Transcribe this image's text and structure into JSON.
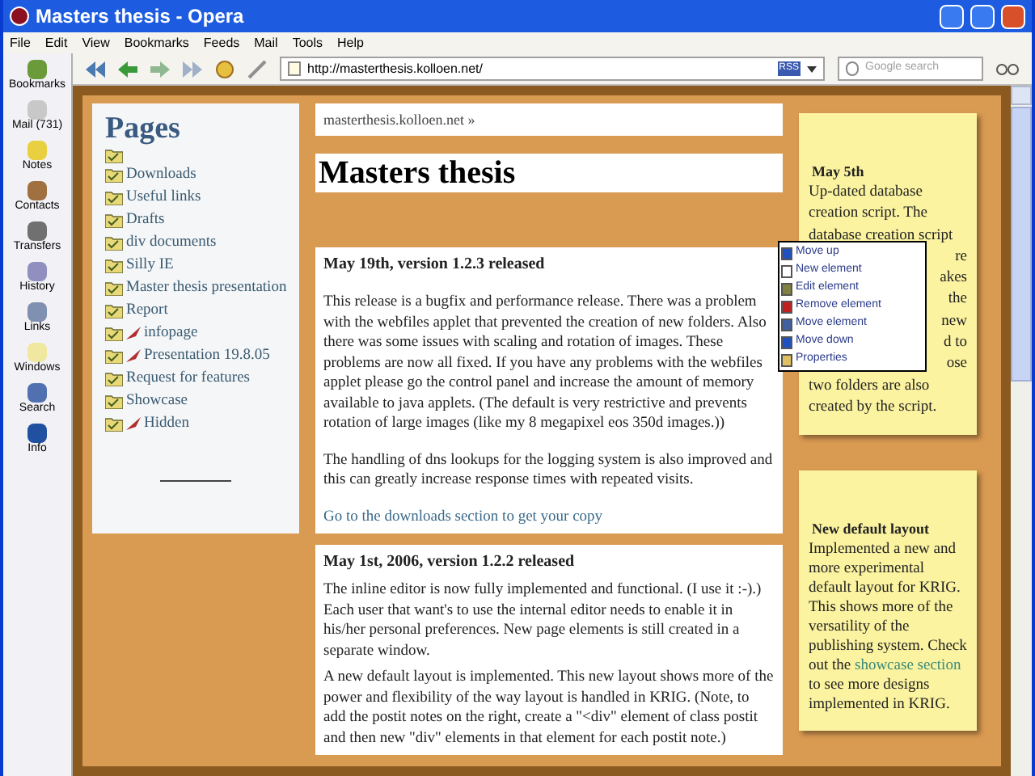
{
  "window": {
    "title": "Masters thesis - Opera"
  },
  "menu": [
    "File",
    "Edit",
    "View",
    "Bookmarks",
    "Feeds",
    "Mail",
    "Tools",
    "Help"
  ],
  "panel": [
    {
      "label": "Bookmarks"
    },
    {
      "label": "Mail (731)"
    },
    {
      "label": "Notes"
    },
    {
      "label": "Contacts"
    },
    {
      "label": "Transfers"
    },
    {
      "label": "History"
    },
    {
      "label": "Links"
    },
    {
      "label": "Windows"
    },
    {
      "label": "Search"
    },
    {
      "label": "Info"
    }
  ],
  "address": {
    "value": "http://masterthesis.kolloen.net/",
    "feed_badge": "RSS"
  },
  "search": {
    "placeholder": "Google search"
  },
  "pages": {
    "title": "Pages",
    "items": [
      {
        "marked": false
      },
      {
        "label": "Downloads",
        "marked": false
      },
      {
        "label": "Useful links",
        "marked": false
      },
      {
        "label": "Drafts",
        "marked": false
      },
      {
        "label": "div documents",
        "marked": false
      },
      {
        "label": "Silly IE",
        "marked": false
      },
      {
        "label": "Master thesis presentation",
        "marked": false
      },
      {
        "label": "Report",
        "marked": false
      },
      {
        "label": "infopage",
        "marked": true
      },
      {
        "label": "Presentation 19.8.05",
        "marked": true
      },
      {
        "label": "Request for features",
        "marked": false
      },
      {
        "label": "Showcase",
        "marked": false
      },
      {
        "label": "Hidden",
        "marked": true
      }
    ]
  },
  "breadcrumb": "masterthesis.kolloen.net »",
  "page_title": "Masters thesis",
  "posts": [
    {
      "title": "May 19th, version 1.2.3 released",
      "paragraphs": [
        {
          "kind": "text",
          "text": "This release is a bugfix and performance release. There was a problem with the webfiles applet that prevented the creation of new folders. Also there was some issues with scaling and rotation of images. These problems are now all fixed. If you have any problems with the webfiles applet please go the control panel and increase the amount of memory available to java applets. (The default is very restrictive and prevents rotation of large images (like my 8 megapixel eos 350d images.))"
        },
        {
          "kind": "text",
          "text": "The handling of dns lookups for the logging system is also improved and this can greatly increase response times with repeated visits."
        },
        {
          "kind": "link",
          "text": "Go to the downloads section to get your copy"
        }
      ]
    },
    {
      "title": "May 1st, 2006, version 1.2.2 released",
      "paragraphs": [
        {
          "kind": "text",
          "text": "The inline editor is now fully implemented and functional. (I use it :-).) Each user that want's to use the internal editor needs to enable it in his/her personal preferences. New page elements is still created in a separate window."
        },
        {
          "kind": "text",
          "text": "A new default layout is implemented. This new layout shows more of the power and flexibility of the way layout is handled in KRIG. (Note, to add the postit notes on the right, create a \"<div\" element of class postit and then new \"div\" elements in that element for each postit note.)"
        }
      ]
    }
  ],
  "context_menu": [
    {
      "label": "Move up"
    },
    {
      "label": "New element"
    },
    {
      "label": "Edit element"
    },
    {
      "label": "Remove element"
    },
    {
      "label": "Move element"
    },
    {
      "label": "Move down"
    },
    {
      "label": "Properties"
    }
  ],
  "notes": [
    {
      "title": "May 5th",
      "lines": [
        {
          "text": "Up-dated database",
          "kind": "full"
        },
        {
          "text": "creation script. The",
          "kind": "full"
        },
        {
          "text": "database creation script",
          "kind": "full"
        },
        {
          "text": "re",
          "kind": "partial"
        },
        {
          "text": "akes",
          "kind": "partial"
        },
        {
          "text": "the",
          "kind": "partial"
        },
        {
          "text": "new",
          "kind": "partial"
        },
        {
          "text": "d to",
          "kind": "partial"
        },
        {
          "text": "ose",
          "kind": "partial"
        },
        {
          "text": "two folders are also",
          "kind": "full"
        },
        {
          "text": "created by the script.",
          "kind": "full"
        }
      ]
    },
    {
      "title": "New default layout",
      "body": [
        {
          "kind": "text",
          "text": "Implemented a new and more experimental default layout for KRIG. This shows more of the versatility of the publishing system. Check out the "
        },
        {
          "kind": "link",
          "text": "showcase section"
        },
        {
          "kind": "text",
          "text": " to see more designs implemented in KRIG."
        }
      ]
    }
  ]
}
